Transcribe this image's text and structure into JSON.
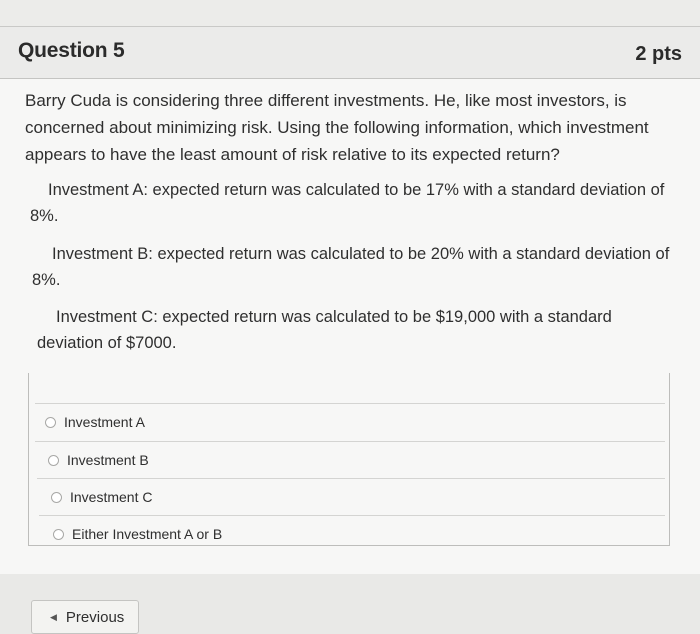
{
  "question": {
    "title": "Question 5",
    "points": "2 pts",
    "prompt": "Barry Cuda is considering three different investments.  He, like most investors, is concerned about minimizing risk.  Using the following information, which investment appears to have the least amount of risk relative to its expected return?",
    "investments": [
      "Investment A:  expected return was calculated to be 17% with a standard deviation of 8%.",
      "Investment B:  expected return was calculated to be 20% with a standard deviation of 8%.",
      "Investment C:  expected return was calculated to be $19,000 with a standard deviation of $7000."
    ],
    "answers": [
      "Investment A",
      "Investment B",
      "Investment C",
      "Either Investment A or B"
    ]
  },
  "navigation": {
    "previous_label": "Previous",
    "previous_icon": "triangle-left-icon"
  }
}
